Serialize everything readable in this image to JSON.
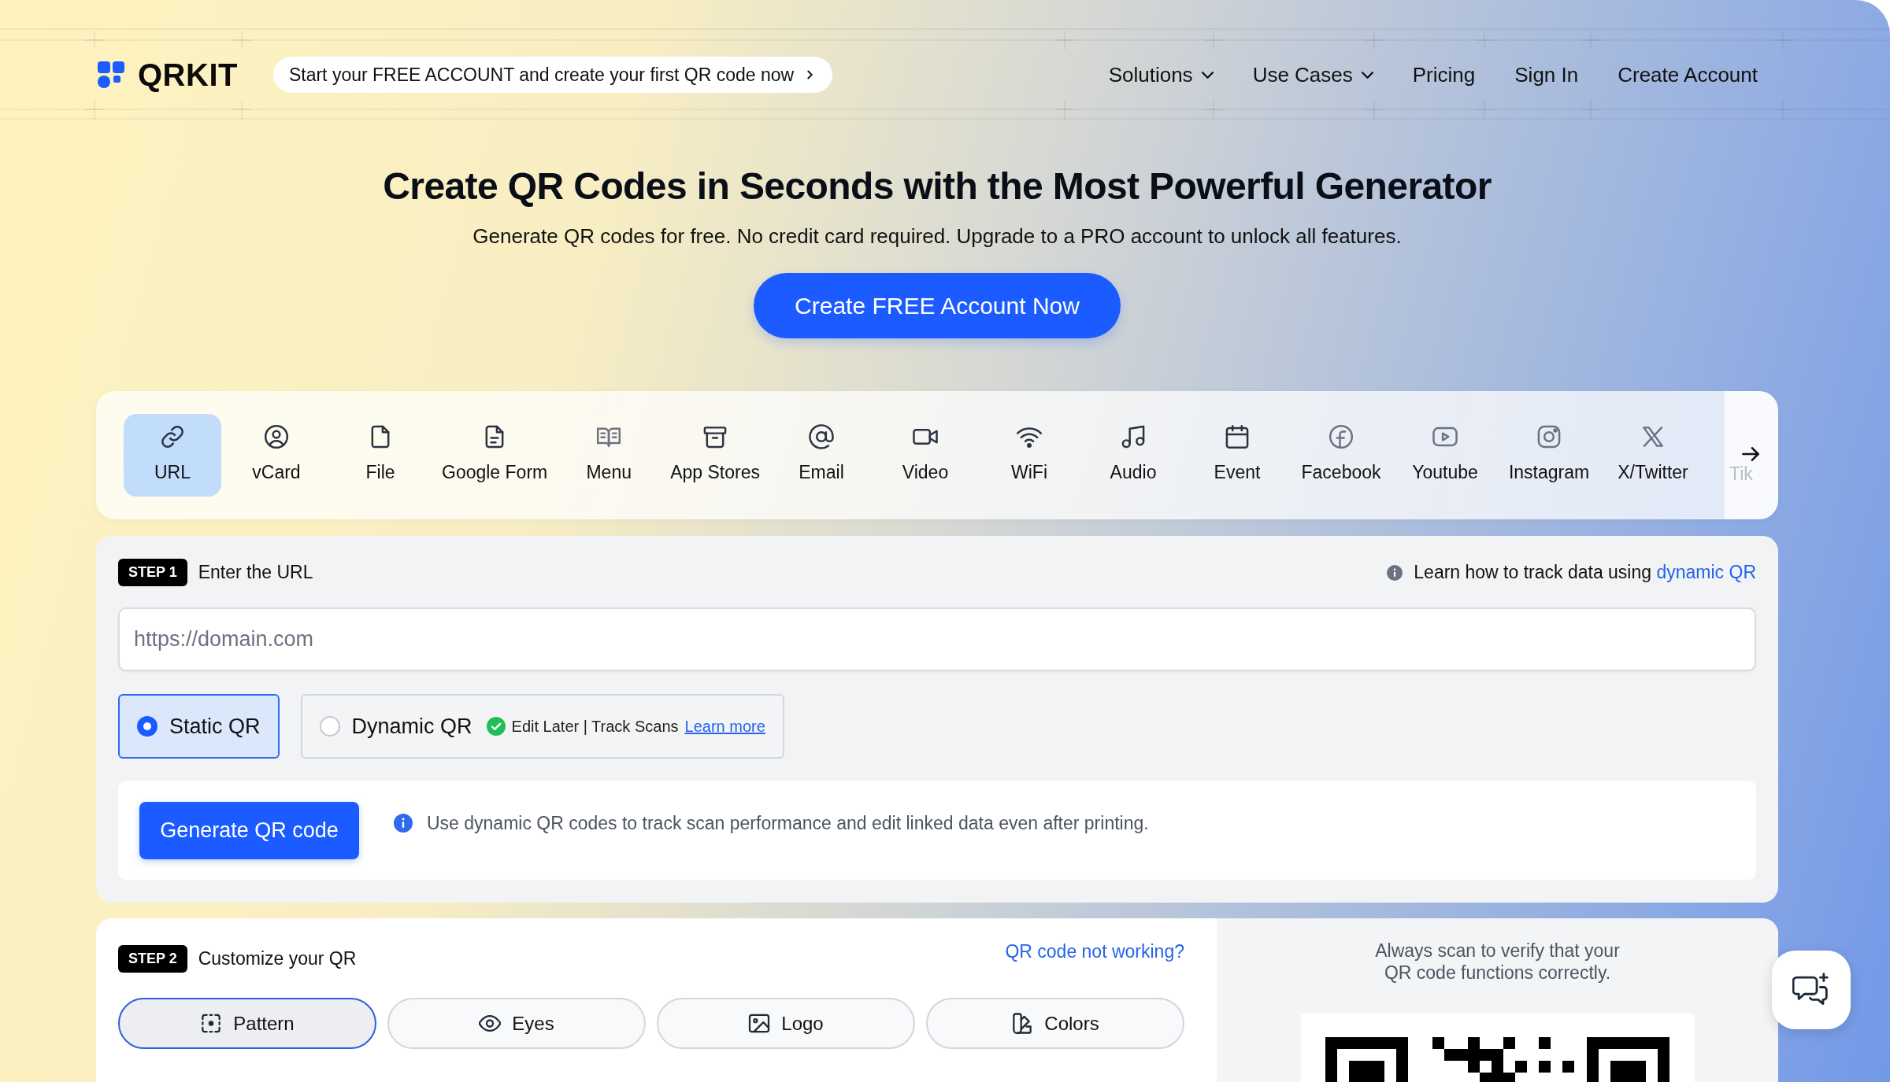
{
  "header": {
    "logo_text": "QRKIT",
    "promo": "Start your FREE ACCOUNT and create your first QR code now",
    "nav": [
      {
        "label": "Solutions",
        "kind": "dropdown"
      },
      {
        "label": "Use Cases",
        "kind": "dropdown"
      },
      {
        "label": "Pricing",
        "kind": "link"
      },
      {
        "label": "Sign In",
        "kind": "link"
      },
      {
        "label": "Create Account",
        "kind": "link"
      }
    ]
  },
  "hero": {
    "title": "Create QR Codes in Seconds with the Most Powerful Generator",
    "subtitle": "Generate QR codes for free. No credit card required. Upgrade to a PRO account to unlock all features.",
    "cta": "Create FREE Account Now"
  },
  "qr_types": {
    "tabs": [
      {
        "label": "URL",
        "selected": true
      },
      {
        "label": "vCard",
        "selected": false
      },
      {
        "label": "File",
        "selected": false
      },
      {
        "label": "Google Form",
        "selected": false
      },
      {
        "label": "Menu",
        "selected": false
      },
      {
        "label": "App Stores",
        "selected": false
      },
      {
        "label": "Email",
        "selected": false
      },
      {
        "label": "Video",
        "selected": false
      },
      {
        "label": "WiFi",
        "selected": false
      },
      {
        "label": "Audio",
        "selected": false
      },
      {
        "label": "Event",
        "selected": false
      },
      {
        "label": "Facebook",
        "selected": false
      },
      {
        "label": "Youtube",
        "selected": false
      },
      {
        "label": "Instagram",
        "selected": false
      },
      {
        "label": "X/Twitter",
        "selected": false
      }
    ],
    "partial_tab": "Tik"
  },
  "step1": {
    "badge": "STEP 1",
    "title": "Enter the URL",
    "help_text": "Learn how to track data using",
    "help_link": "dynamic QR",
    "url_field": {
      "placeholder": "https://domain.com"
    },
    "modes": [
      {
        "label": "Static QR",
        "selected": true
      },
      {
        "label": "Dynamic QR",
        "selected": false,
        "perk": "Edit Later | Track Scans",
        "link": "Learn more"
      }
    ],
    "generate_button": "Generate QR code",
    "tip": "Use dynamic QR codes to track scan performance and edit linked data even after printing."
  },
  "step2": {
    "badge": "STEP 2",
    "title": "Customize your QR",
    "help_link": "QR code not working?",
    "options": [
      {
        "label": "Pattern",
        "selected": true
      },
      {
        "label": "Eyes",
        "selected": false
      },
      {
        "label": "Logo",
        "selected": false
      },
      {
        "label": "Colors",
        "selected": false
      }
    ],
    "preview_note": "Always scan to verify that your QR code functions correctly."
  }
}
